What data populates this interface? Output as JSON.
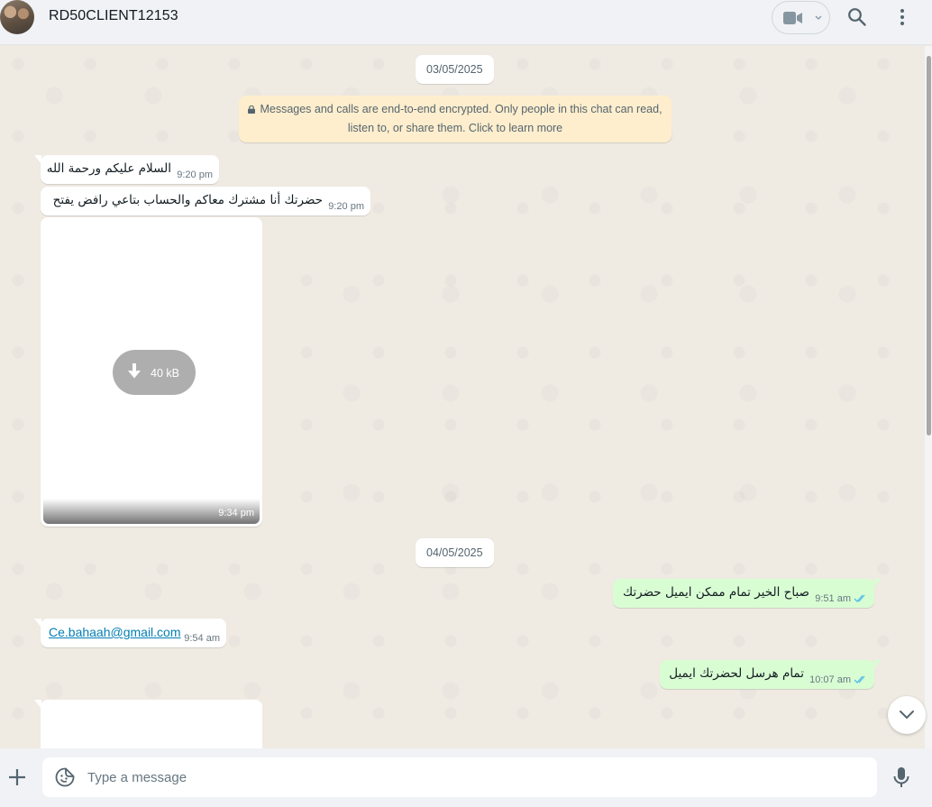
{
  "header": {
    "contact_name": "RD50CLIENT12153"
  },
  "chat": {
    "dates": [
      "03/05/2025",
      "04/05/2025"
    ],
    "encryption_notice_line1": "Messages and calls are end-to-end encrypted. Only people in this chat can read,",
    "encryption_notice_line2": "listen to, or share them. Click to learn more",
    "messages": [
      {
        "direction": "incoming",
        "text": "السلام عليكم ورحمة الله",
        "time": "9:20 pm"
      },
      {
        "direction": "incoming",
        "text": "حضرتك أنا مشترك معاكم والحساب بتاعي رافض يفتح",
        "time": "9:20 pm"
      },
      {
        "direction": "incoming",
        "type": "media",
        "size": "40 kB",
        "time": "9:34 pm"
      },
      {
        "direction": "outgoing",
        "text": "صباح الخير تمام ممكن ايميل حضرتك",
        "time": "9:51 am",
        "status": "read"
      },
      {
        "direction": "incoming",
        "text": "Ce.bahaah@gmail.com",
        "time": "9:54 am",
        "is_link": true
      },
      {
        "direction": "outgoing",
        "text": "تمام هرسل لحضرتك ايميل",
        "time": "10:07 am",
        "status": "read"
      }
    ]
  },
  "composer": {
    "placeholder": "Type a message"
  },
  "colors": {
    "outgoing_bubble": "#d9fdd3",
    "incoming_bubble": "#ffffff",
    "read_ticks": "#53bdeb",
    "link": "#027eb5"
  }
}
